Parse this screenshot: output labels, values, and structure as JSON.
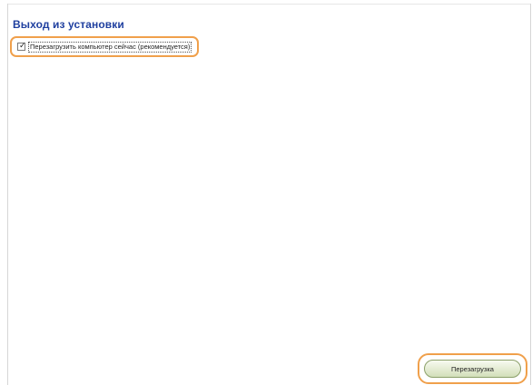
{
  "header": {
    "title": "Выход из установки"
  },
  "options": {
    "restart_now_label": "Перезагрузить компьютер сейчас (рекомендуется)",
    "restart_now_checked": true
  },
  "footer": {
    "restart_button_label": "Перезагрузка"
  },
  "colors": {
    "title": "#1f3f9f",
    "highlight": "#f0a04b",
    "button_border": "#8ca06a"
  }
}
